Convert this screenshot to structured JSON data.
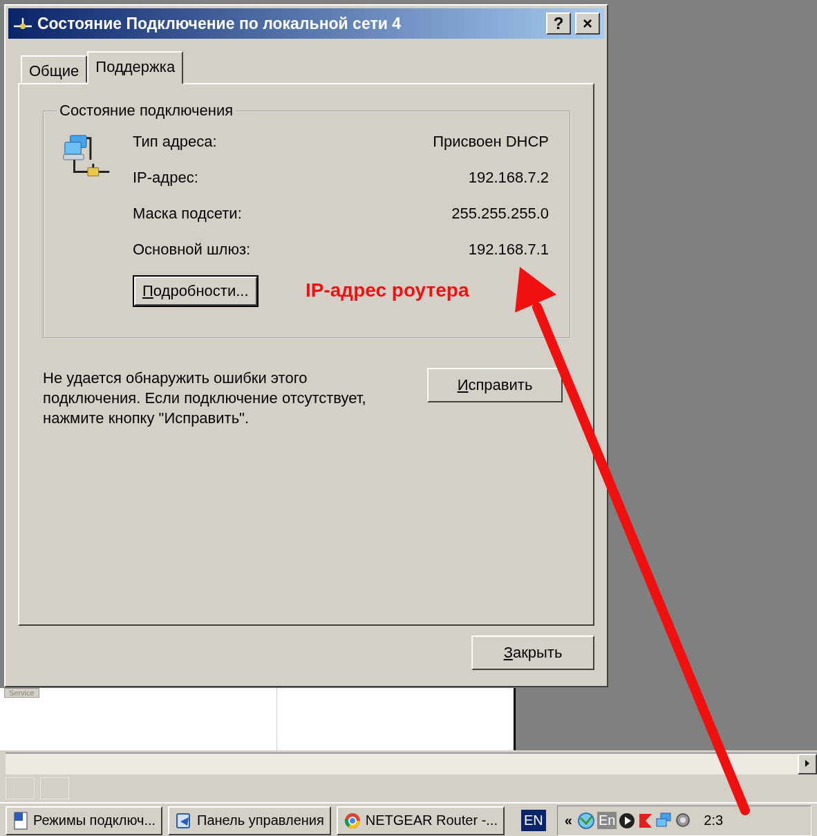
{
  "window": {
    "title": "Состояние Подключение по локальной сети 4",
    "help_button": "?",
    "close_button": "×"
  },
  "tabs": [
    {
      "label": "Общие",
      "selected": false
    },
    {
      "label": "Поддержка",
      "selected": true
    }
  ],
  "connection_status": {
    "title": "Состояние подключения",
    "rows": [
      {
        "label": "Тип адреса:",
        "value": "Присвоен DHCP"
      },
      {
        "label": "IP-адрес:",
        "value": "192.168.7.2"
      },
      {
        "label": "Маска подсети:",
        "value": "255.255.255.0"
      },
      {
        "label": "Основной шлюз:",
        "value": "192.168.7.1"
      }
    ],
    "details_button": "Подробности..."
  },
  "message": "Не удается обнаружить ошибки этого подключения. Если подключение отсутствует, нажмите кнопку \"Исправить\".",
  "repair_button": "Исправить",
  "close_dialog_button": "Закрыть",
  "background_window": {
    "tab": "Service"
  },
  "annotation": {
    "text": "IP-адрес роутера"
  },
  "taskbar": {
    "buttons": [
      {
        "label": "Режимы подключ...",
        "kind": "document"
      },
      {
        "label": "Панель управления",
        "kind": "control-panel"
      },
      {
        "label": "NETGEAR Router -...",
        "kind": "browser"
      }
    ],
    "language": "EN",
    "tray_expand": "«",
    "tray_language": "En",
    "clock": "2:3"
  }
}
